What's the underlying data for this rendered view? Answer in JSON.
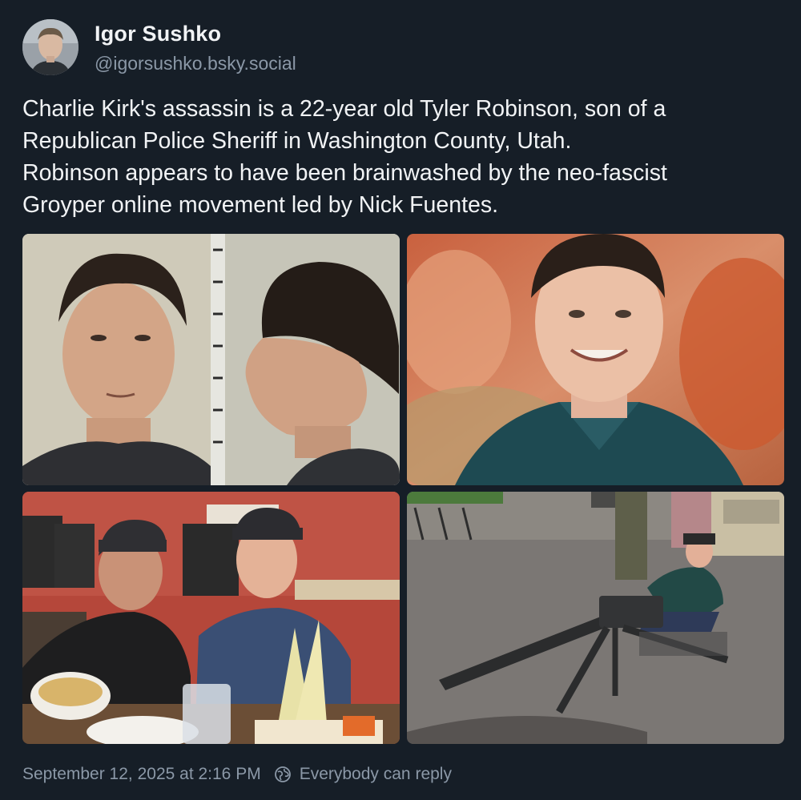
{
  "author": {
    "display_name": "Igor Sushko",
    "handle": "@igorsushko.bsky.social",
    "avatar_icon": "avatar-photo"
  },
  "post": {
    "text": "Charlie Kirk's assassin is a 22-year old Tyler Robinson, son of a\nRepublican Police Sheriff in Washington County, Utah.\nRobinson appears to have been brainwashed by the neo-fascist\nGroyper online movement led by Nick Fuentes."
  },
  "images": [
    {
      "id": "mugshot",
      "description_icon": "photo-mugshot"
    },
    {
      "id": "portrait",
      "description_icon": "photo-portrait"
    },
    {
      "id": "restaurant",
      "description_icon": "photo-restaurant"
    },
    {
      "id": "machine-gun",
      "description_icon": "photo-machine-gun"
    }
  ],
  "footer": {
    "timestamp": "September 12, 2025 at 2:16 PM",
    "reply_setting": "Everybody can reply",
    "reply_icon": "globe-icon"
  },
  "colors": {
    "background": "#161e27",
    "text": "#f1f3f5",
    "muted": "#8b98a7"
  }
}
